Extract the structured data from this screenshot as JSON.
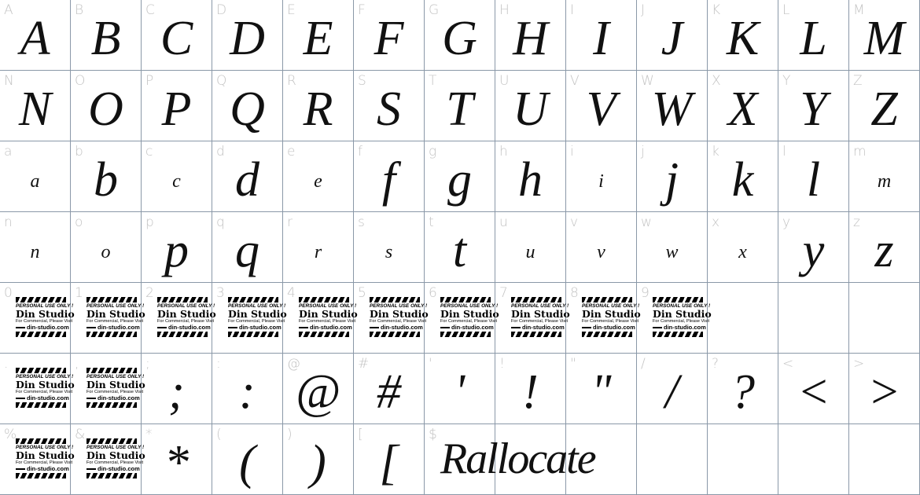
{
  "watermark": {
    "line1": "PERSONAL USE ONLY !",
    "line2": "Din Studio",
    "line3": "For Commercial, Please Visit",
    "line4": "din-studio.com"
  },
  "sample_text": "Rallocate",
  "cells": [
    {
      "label": "A",
      "glyph": "A"
    },
    {
      "label": "B",
      "glyph": "B"
    },
    {
      "label": "C",
      "glyph": "C"
    },
    {
      "label": "D",
      "glyph": "D"
    },
    {
      "label": "E",
      "glyph": "E"
    },
    {
      "label": "F",
      "glyph": "F"
    },
    {
      "label": "G",
      "glyph": "G"
    },
    {
      "label": "H",
      "glyph": "H"
    },
    {
      "label": "I",
      "glyph": "I"
    },
    {
      "label": "J",
      "glyph": "J"
    },
    {
      "label": "K",
      "glyph": "K"
    },
    {
      "label": "L",
      "glyph": "L"
    },
    {
      "label": "M",
      "glyph": "M"
    },
    {
      "label": "N",
      "glyph": "N"
    },
    {
      "label": "O",
      "glyph": "O"
    },
    {
      "label": "P",
      "glyph": "P"
    },
    {
      "label": "Q",
      "glyph": "Q"
    },
    {
      "label": "R",
      "glyph": "R"
    },
    {
      "label": "S",
      "glyph": "S"
    },
    {
      "label": "T",
      "glyph": "T"
    },
    {
      "label": "U",
      "glyph": "U"
    },
    {
      "label": "V",
      "glyph": "V"
    },
    {
      "label": "W",
      "glyph": "W"
    },
    {
      "label": "X",
      "glyph": "X"
    },
    {
      "label": "Y",
      "glyph": "Y"
    },
    {
      "label": "Z",
      "glyph": "Z"
    },
    {
      "label": "a",
      "glyph": "a",
      "small": true
    },
    {
      "label": "b",
      "glyph": "b"
    },
    {
      "label": "c",
      "glyph": "c",
      "small": true
    },
    {
      "label": "d",
      "glyph": "d"
    },
    {
      "label": "e",
      "glyph": "e",
      "small": true
    },
    {
      "label": "f",
      "glyph": "f"
    },
    {
      "label": "g",
      "glyph": "g"
    },
    {
      "label": "h",
      "glyph": "h"
    },
    {
      "label": "i",
      "glyph": "i",
      "small": true
    },
    {
      "label": "j",
      "glyph": "j"
    },
    {
      "label": "k",
      "glyph": "k"
    },
    {
      "label": "l",
      "glyph": "l"
    },
    {
      "label": "m",
      "glyph": "m",
      "small": true
    },
    {
      "label": "n",
      "glyph": "n",
      "small": true
    },
    {
      "label": "o",
      "glyph": "o",
      "small": true
    },
    {
      "label": "p",
      "glyph": "p"
    },
    {
      "label": "q",
      "glyph": "q"
    },
    {
      "label": "r",
      "glyph": "r",
      "small": true
    },
    {
      "label": "s",
      "glyph": "s",
      "small": true
    },
    {
      "label": "t",
      "glyph": "t"
    },
    {
      "label": "u",
      "glyph": "u",
      "small": true
    },
    {
      "label": "v",
      "glyph": "v",
      "small": true
    },
    {
      "label": "w",
      "glyph": "w",
      "small": true
    },
    {
      "label": "x",
      "glyph": "x",
      "small": true
    },
    {
      "label": "y",
      "glyph": "y"
    },
    {
      "label": "z",
      "glyph": "z"
    },
    {
      "label": "0",
      "watermark": true
    },
    {
      "label": "1",
      "watermark": true
    },
    {
      "label": "2",
      "watermark": true
    },
    {
      "label": "3",
      "watermark": true
    },
    {
      "label": "4",
      "watermark": true
    },
    {
      "label": "5",
      "watermark": true
    },
    {
      "label": "6",
      "watermark": true
    },
    {
      "label": "7",
      "watermark": true
    },
    {
      "label": "8",
      "watermark": true
    },
    {
      "label": "9",
      "watermark": true
    },
    {
      "label": ""
    },
    {
      "label": ""
    },
    {
      "label": ""
    },
    {
      "label": ".",
      "watermark": true
    },
    {
      "label": ",",
      "watermark": true
    },
    {
      "label": ";",
      "glyph": ";"
    },
    {
      "label": ":",
      "glyph": ":"
    },
    {
      "label": "@",
      "glyph": "@"
    },
    {
      "label": "#",
      "glyph": "#"
    },
    {
      "label": "'",
      "glyph": "'"
    },
    {
      "label": "!",
      "glyph": "!"
    },
    {
      "label": "\"",
      "glyph": "\""
    },
    {
      "label": "/",
      "glyph": "/"
    },
    {
      "label": "?",
      "glyph": "?"
    },
    {
      "label": "<",
      "glyph": "<"
    },
    {
      "label": ">",
      "glyph": ">"
    },
    {
      "label": "%",
      "watermark": true
    },
    {
      "label": "&",
      "watermark": true
    },
    {
      "label": "*",
      "glyph": "*"
    },
    {
      "label": "(",
      "glyph": "("
    },
    {
      "label": ")",
      "glyph": ")"
    },
    {
      "label": "[",
      "glyph": "["
    },
    {
      "label": "$"
    },
    {
      "label": ""
    },
    {
      "label": ""
    },
    {
      "label": ""
    },
    {
      "label": ""
    },
    {
      "label": ""
    },
    {
      "label": ""
    }
  ]
}
